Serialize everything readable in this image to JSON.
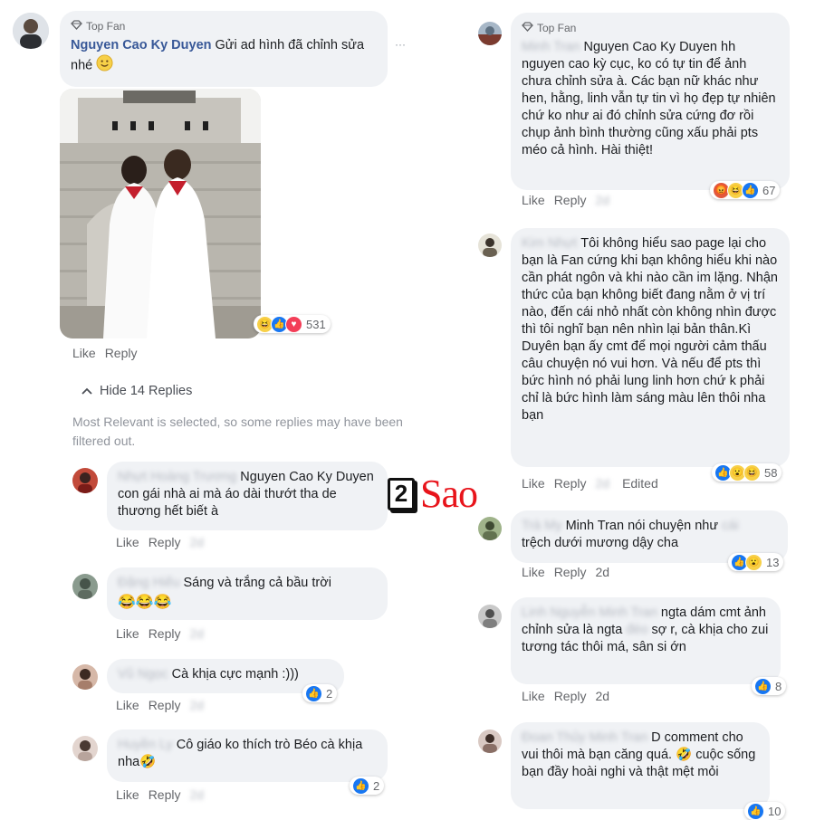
{
  "left_column": {
    "main_comment": {
      "badge": "Top Fan",
      "author": "Nguyen Cao Ky Duyen",
      "text": "Gửi ad hình đã chỉnh sửa nhé",
      "emoji": "slightly-smiling-face",
      "photo_reactions_count": "531",
      "like": "Like",
      "reply": "Reply",
      "more": "···"
    },
    "hide_replies": "Hide 14 Replies",
    "filter_notice": "Most Relevant is selected, so some replies may have been filtered out.",
    "replies": [
      {
        "author": "Nhựt Hoàng Trương",
        "text": "Nguyen Cao Ky Duyen con gái nhà ai mà áo dài thướt tha de thương hết biết à",
        "like": "Like",
        "reply": "Reply",
        "time": "2d"
      },
      {
        "author": "Đặng Hiếu",
        "text": "Sáng và trắng cả bầu trời",
        "emojis": "😂😂😂",
        "like": "Like",
        "reply": "Reply",
        "time": "2d"
      },
      {
        "author": "Vũ Ngọc",
        "text": "Cà khịa cực mạnh :)))",
        "like": "Like",
        "reply": "Reply",
        "time": "2d",
        "reactions": "2"
      },
      {
        "author": "Huyền Ly",
        "text": "Cô giáo ko thích trò Béo cà khịa nha",
        "emoji_end": "🤣",
        "like": "Like",
        "reply": "Reply",
        "time": "2d",
        "reactions": "2"
      }
    ]
  },
  "right_column": {
    "comments": [
      {
        "badge": "Top Fan",
        "author": "Minh Tran",
        "text": "Nguyen Cao Ky Duyen hh nguyen cao kỳ cục, ko có tự tin để ảnh chưa chỉnh sửa à. Các bạn nữ khác như hen, hằng, linh vẫn tự tin vì họ đẹp tự nhiên chứ ko như ai đó chỉnh sửa cứng đơ rồi chụp ảnh bình thường cũng xấu phải pts méo cả hình. Hài thiệt!",
        "like": "Like",
        "reply": "Reply",
        "time": "2d",
        "reactions": "67"
      },
      {
        "author": "Kim Nhựt",
        "text": "Tôi không hiểu sao page lại cho bạn là Fan cứng khi bạn không hiểu khi nào cần phát ngôn và khi nào cần im lặng. Nhận thức của bạn không biết đang nằm ở vị trí nào, đến cái nhỏ nhất còn không nhìn được thì tôi nghĩ bạn nên nhìn lại bản thân.Kì Duyên bạn ấy cmt để mọi người cảm thấu câu chuyện nó vui hơn. Và nếu để pts thì bức hình nó phải lung linh hơn chứ k phải chỉ là bức hình làm sáng màu lên thôi nha bạn",
        "like": "Like",
        "reply": "Reply",
        "time": "2d",
        "edited": "Edited",
        "reactions": "58"
      },
      {
        "author": "Trà My",
        "text": "Minh Tran nói chuyện như",
        "text_blur": "cái",
        "text2": "trệch dưới mương dậy cha",
        "like": "Like",
        "reply": "Reply",
        "time": "2d",
        "reactions": "13"
      },
      {
        "author": "Linh Nguyễn Minh Tran",
        "text": "ngta dám cmt ảnh chỉnh sửa là ngta",
        "text_blur": "đéo",
        "text2": "sợ r, cà khịa cho zui tương tác thôi má, sân si ớn",
        "like": "Like",
        "reply": "Reply",
        "time": "2d",
        "reactions": "8"
      },
      {
        "author": "Đoan Thủy Minh Tran",
        "text": "D comment cho vui thôi mà bạn căng quá.",
        "emoji_mid": "🤣",
        "text2": "cuộc sống bạn đầy hoài nghi và thật mệt mỏi",
        "reactions": "10"
      }
    ]
  },
  "watermark": {
    "digit": "2",
    "word": "Sao"
  },
  "colors": {
    "author_blue": "#385898",
    "bubble_bg": "#f0f2f5",
    "meta_gray": "#65676b",
    "like_blue": "#1877f2",
    "logo_red": "#e8141b"
  }
}
